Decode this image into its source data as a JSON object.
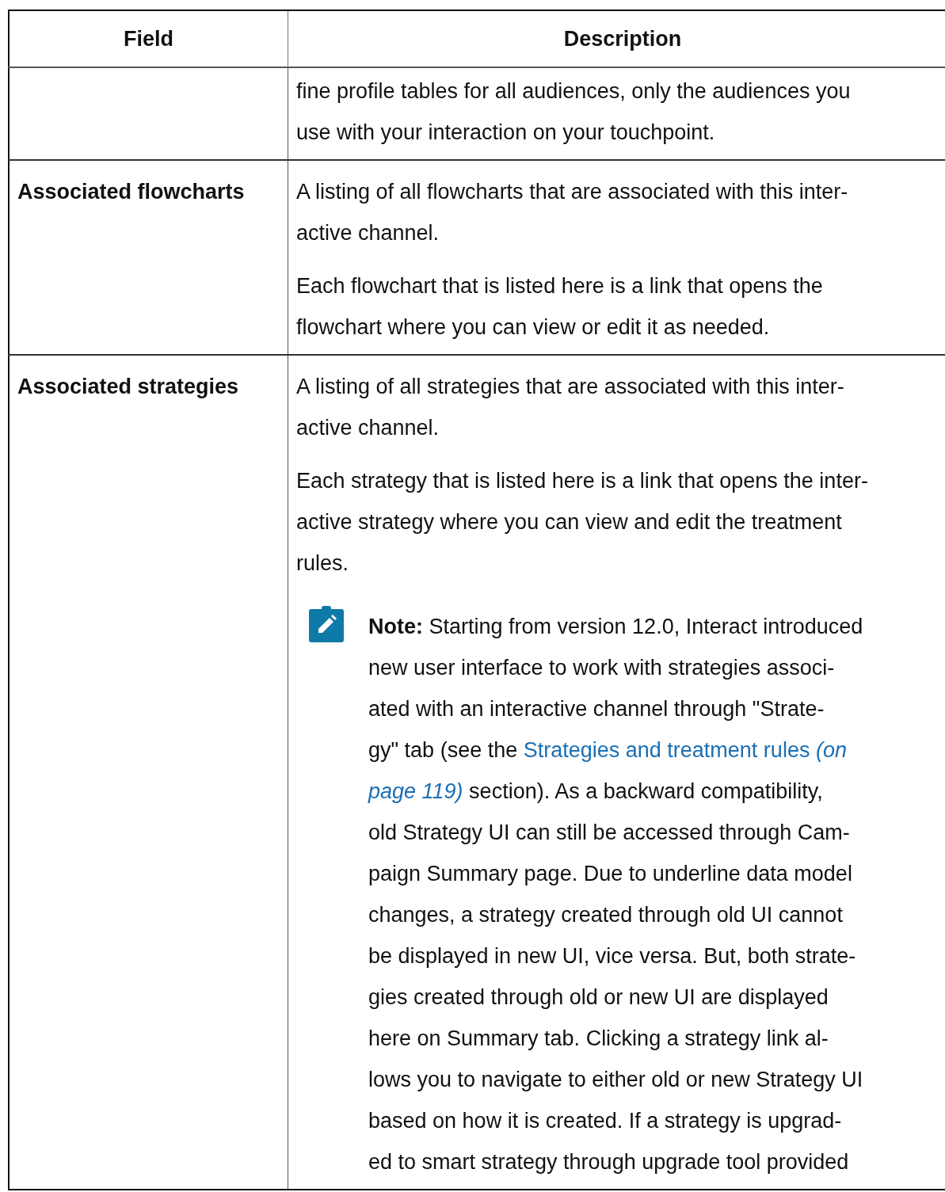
{
  "table": {
    "columns": [
      "Field",
      "Description"
    ],
    "rows": [
      {
        "paragraphs": [
          "fine profile tables for all audiences, only the audiences you\nuse with your interaction on your touchpoint."
        ]
      },
      {
        "field": "Associated flowcharts",
        "paragraphs": [
          "A listing of all flowcharts that are associated with this inter-\nactive channel.",
          "Each flowchart that is listed here is a link that opens the\nflowchart where you can view or edit it as needed."
        ]
      },
      {
        "field": "Associated strategies",
        "paragraphs": [
          "A listing of all strategies that are associated with this inter-\nactive channel.",
          "Each strategy that is listed here is a link that opens the inter-\nactive strategy where you can view and edit the treatment\nrules."
        ],
        "note": {
          "label": "Note:",
          "parts": [
            {
              "kind": "text",
              "text": " Starting from version 12.0, Interact introduced\nnew user interface to work with strategies associ-\nated with an interactive channel through \"Strate-\ngy\" tab (see the "
            },
            {
              "kind": "link",
              "text": "Strategies and treatment rules"
            },
            {
              "kind": "ref",
              "text": " (on\npage 119)"
            },
            {
              "kind": "text",
              "text": " section). As a backward compatibility,\nold Strategy UI can still be accessed through Cam-\npaign Summary page. Due to underline data model\nchanges, a strategy created through old UI cannot\nbe displayed in new UI, vice versa. But, both strate-\ngies created through old or new UI are displayed\nhere on Summary tab. Clicking a strategy link al-\nlows you to navigate to either old or new Strategy UI\nbased on how it is created. If a strategy is upgrad-\ned to smart strategy through upgrade tool provided"
            }
          ]
        }
      }
    ]
  }
}
